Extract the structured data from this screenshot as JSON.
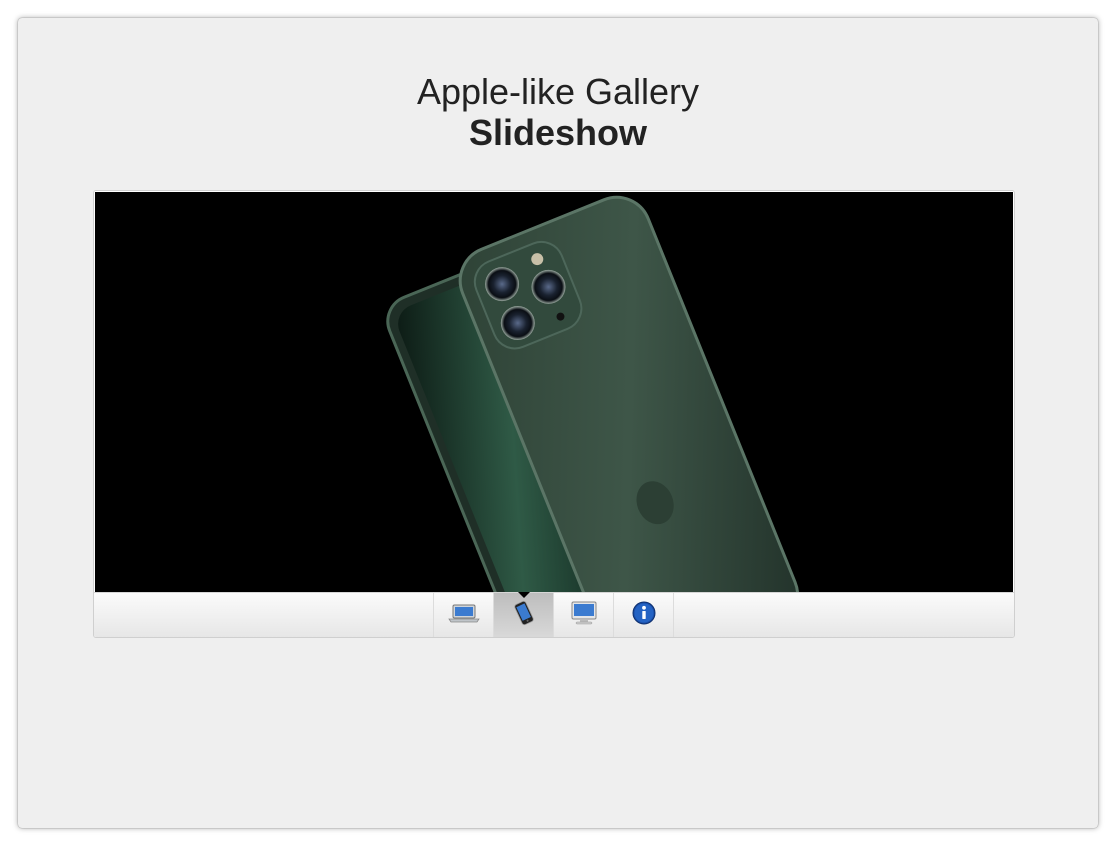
{
  "header": {
    "title_line1": "Apple-like Gallery",
    "title_line2": "Slideshow"
  },
  "slideshow": {
    "current_index": 1,
    "slide_subject": "phone-photo",
    "thumbnails": [
      {
        "icon": "laptop-icon",
        "active": false
      },
      {
        "icon": "phone-icon",
        "active": true
      },
      {
        "icon": "desktop-monitor-icon",
        "active": false
      },
      {
        "icon": "info-icon",
        "active": false
      }
    ]
  },
  "colors": {
    "background": "#efefef",
    "slide_background": "#000000",
    "title_text": "#222222",
    "phone_green": "#3a4f43",
    "info_blue": "#1b4fa8"
  }
}
